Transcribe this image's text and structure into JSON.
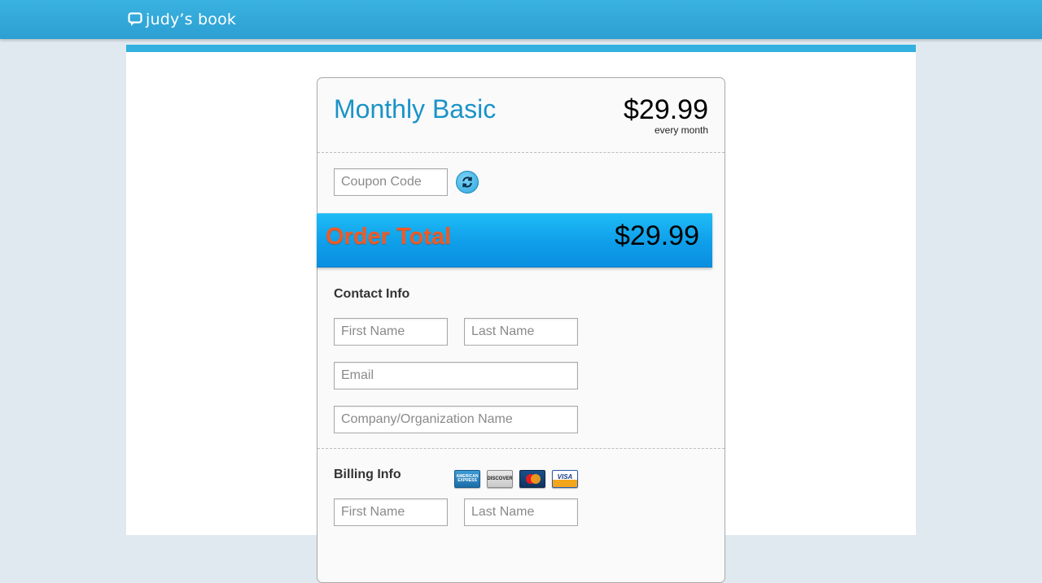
{
  "header": {
    "brand": "judy’s book"
  },
  "plan": {
    "name": "Monthly Basic",
    "price": "$29.99",
    "period": "every month"
  },
  "coupon": {
    "placeholder": "Coupon Code"
  },
  "order_total": {
    "label": "Order Total",
    "amount": "$29.99"
  },
  "contact_info": {
    "title": "Contact Info",
    "first_name_placeholder": "First Name",
    "last_name_placeholder": "Last Name",
    "email_placeholder": "Email",
    "company_placeholder": "Company/Organization Name"
  },
  "billing_info": {
    "title": "Billing Info",
    "first_name_placeholder": "First Name",
    "last_name_placeholder": "Last Name",
    "accepted_cards": [
      "AMERICAN EXPRESS",
      "DISCOVER",
      "MasterCard",
      "VISA"
    ]
  },
  "colors": {
    "brand_blue": "#33b0e0",
    "plan_title": "#1a93c8",
    "order_total_label": "#f05a24"
  }
}
